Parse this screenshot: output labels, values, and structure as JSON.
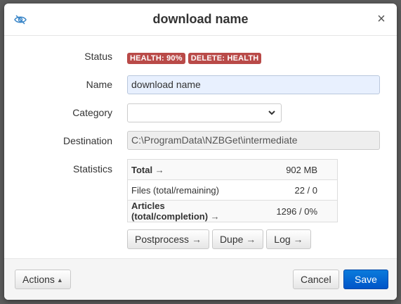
{
  "dialog": {
    "title": "download name",
    "close_label": "×"
  },
  "labels": {
    "status": "Status",
    "name": "Name",
    "category": "Category",
    "destination": "Destination",
    "statistics": "Statistics"
  },
  "status_badges": [
    "HEALTH: 90%",
    "DELETE: HEALTH"
  ],
  "fields": {
    "name_value": "download name",
    "category_value": "",
    "destination_value": "C:\\ProgramData\\NZBGet\\intermediate"
  },
  "statistics": [
    {
      "label": "Total",
      "arrow": "→",
      "value": "902 MB"
    },
    {
      "label": "Files (total/remaining)",
      "arrow": "",
      "value": "22 / 0"
    },
    {
      "label": "Articles (total/completion)",
      "arrow": "→",
      "value": "1296 / 0%"
    }
  ],
  "action_buttons": [
    {
      "label": "Postprocess",
      "arrow": "→"
    },
    {
      "label": "Dupe",
      "arrow": "→"
    },
    {
      "label": "Log",
      "arrow": "→"
    }
  ],
  "footer": {
    "actions_label": "Actions",
    "cancel_label": "Cancel",
    "save_label": "Save"
  },
  "colors": {
    "badge": "#b94a48",
    "primary": "#0a6fd6",
    "name_input_bg": "#e8f0fe"
  },
  "icons": {
    "visibility": "eye-slash-icon",
    "close": "close-icon",
    "category": "chevron-down-icon",
    "actions": "caret-up-icon"
  }
}
